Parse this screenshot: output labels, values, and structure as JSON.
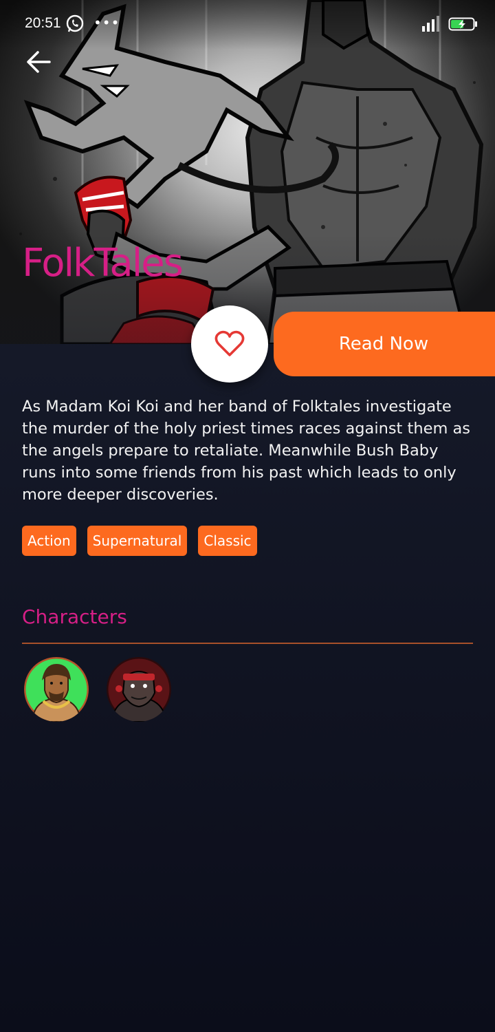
{
  "status_bar": {
    "time": "20:51",
    "icons": [
      "whatsapp-icon",
      "more-dots-icon",
      "signal-icon",
      "battery-charging-icon"
    ]
  },
  "comic": {
    "title": "FolkTales",
    "description": "As Madam Koi Koi and her band of Folktales investigate the murder of the holy priest times races against them as the angels prepare to retaliate. Meanwhile Bush Baby runs into some friends from his past which leads to only more deeper discoveries.",
    "genres": [
      "Action",
      "Supernatural",
      "Classic"
    ]
  },
  "actions": {
    "read_label": "Read Now",
    "favorite_icon": "heart-outline-icon",
    "back_icon": "arrow-left-icon"
  },
  "characters": {
    "heading": "Characters",
    "avatars": [
      "character-avatar-green",
      "character-avatar-red"
    ]
  },
  "colors": {
    "accent_orange": "#fd6a1f",
    "accent_magenta": "#d61f86",
    "background_dark": "#141827",
    "heart_red": "#e53935"
  }
}
